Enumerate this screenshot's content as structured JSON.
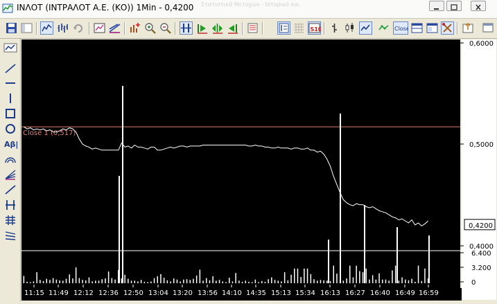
{
  "window": {
    "title": "ΙΝΛΟΤ (ΙΝΤΡΑΛΟΤ Α.Ε. (ΚΟ)) 1Min - 0,4200",
    "background_ghost_text": "Στατιστικά Μετοχών - Ιστορικό και",
    "buttons": [
      "minimize",
      "maximize",
      "close"
    ]
  },
  "toolbar": {
    "close_button_label": "Close",
    "scale_icon_label": "S\n10",
    "buttons": [
      "save-icon",
      "window-icon",
      "line-chart-icon",
      "bar-chart-icon",
      "refresh-icon",
      "chart-settings-icon",
      "indicator-icon",
      "add-indicator-icon",
      "zoom-in-icon",
      "zoom-out-icon",
      "split-panes-icon",
      "scroll-right-icon",
      "scroll-both-icon",
      "scroll-left-icon",
      "data-window-icon",
      "period-icon",
      "grid-icon",
      "scale-icon",
      "ohlc-icon",
      "candlestick-icon",
      "line-style-icon",
      "close-line-icon",
      "close-button",
      "panes-icon",
      "template-icon",
      "tools-icon",
      "export-icon",
      "new-window-icon"
    ]
  },
  "left_tools": [
    "chart-type-icon",
    "trendline-icon",
    "horizontal-line-icon",
    "vertical-line-icon",
    "rectangle-icon",
    "ellipse-icon",
    "text-tool-icon",
    "arc-icon",
    "fan-icon",
    "ray-icon",
    "channel-icon",
    "fibonacci-icon",
    "pitchfork-icon"
  ],
  "text_tool_label": "Αβ|",
  "colors": {
    "plot_bg": "#000000",
    "price_line": "#ffffff",
    "volume_bars": "#ffffff",
    "reference_line": "#e08070",
    "reference_label": "#e08070",
    "axis_panel": "#ffffff",
    "divider": "#ffffff"
  },
  "chart_data": [
    {
      "type": "line",
      "series": [
        {
          "values": [
            0.517,
            0.515,
            0.516,
            0.514,
            0.515,
            0.514,
            0.515,
            0.513,
            0.514,
            0.512,
            0.512,
            0.513,
            0.515,
            0.514,
            0.516,
            0.515,
            0.512,
            0.505,
            0.5,
            0.498,
            0.497,
            0.495,
            0.496,
            0.495,
            0.494,
            0.494,
            0.494,
            0.494,
            0.494,
            0.494,
            0.501,
            0.497,
            0.498,
            0.496,
            0.499,
            0.497,
            0.497,
            0.496,
            0.495,
            0.497,
            0.497,
            0.494,
            0.494,
            0.495,
            0.496,
            0.497,
            0.496,
            0.497,
            0.498,
            0.498,
            0.497,
            0.498,
            0.498,
            0.498,
            0.498,
            0.499,
            0.499,
            0.499,
            0.499,
            0.499,
            0.499,
            0.499,
            0.499,
            0.499,
            0.499,
            0.499,
            0.499,
            0.499,
            0.499,
            0.498,
            0.498,
            0.499,
            0.498,
            0.498,
            0.497,
            0.497,
            0.496,
            0.496,
            0.497,
            0.496,
            0.496,
            0.496,
            0.495,
            0.496,
            0.496,
            0.495,
            0.495,
            0.496,
            0.494,
            0.494,
            0.492,
            0.493,
            0.49,
            0.485,
            0.478,
            0.468,
            0.46,
            0.452,
            0.445,
            0.442,
            0.44,
            0.439,
            0.441,
            0.44,
            0.44,
            0.438,
            0.437,
            0.438,
            0.436,
            0.434,
            0.433,
            0.432,
            0.43,
            0.428,
            0.427,
            0.425,
            0.426,
            0.424,
            0.422,
            0.425,
            0.42,
            0.422,
            0.419,
            0.421,
            0.424
          ]
        }
      ],
      "x_tick_labels": [
        "11:15",
        "11:49",
        "12:12",
        "12:36",
        "12:50",
        "13:04",
        "13:20",
        "13:56",
        "14:10",
        "14:35",
        "15:13",
        "15:34",
        "16:13",
        "16:27",
        "16:40",
        "16:49",
        "16:59"
      ],
      "y_tick_labels": [
        "0,6000",
        "0,5000",
        "0,4000"
      ],
      "ylim": [
        0.4,
        0.6
      ],
      "current_value_label": "0,4200",
      "current_value": 0.42,
      "reference_line": {
        "label": "Close 1 (0,517)",
        "value": 0.517
      },
      "grid": false
    },
    {
      "type": "bar",
      "y_tick_labels": [
        "6.400",
        "3.200",
        "0"
      ],
      "ylim": [
        0,
        8500
      ],
      "values": [
        2000,
        400,
        300,
        500,
        3000,
        900,
        600,
        1200,
        900,
        1400,
        1000,
        800,
        700,
        1200,
        2400,
        1300,
        4300,
        1400,
        900,
        800,
        1600,
        500,
        700,
        700,
        1100,
        1300,
        3200,
        1400,
        1000,
        3600,
        1300,
        2300,
        1200,
        700,
        700,
        500,
        900,
        400,
        300,
        500,
        1400,
        1900,
        2500,
        1500,
        800,
        500,
        1300,
        1000,
        500,
        1000,
        1100,
        900,
        1200,
        2100,
        3700,
        700,
        1400,
        800,
        1900,
        700,
        900,
        500,
        300,
        1500,
        500,
        2800,
        700,
        400,
        700,
        400,
        300,
        1000,
        300,
        600,
        400,
        1100,
        1600,
        900,
        700,
        500,
        3000,
        800,
        2300,
        4000,
        4000,
        1700,
        4000,
        4000,
        2500,
        1100,
        700,
        900,
        800,
        700,
        600,
        4800,
        2600,
        800,
        700,
        1300,
        4800,
        1600,
        4800,
        3300,
        3000,
        4000,
        1000,
        2200,
        1000,
        2700,
        1000,
        1000,
        700,
        3500,
        4800,
        700,
        1600,
        1000,
        800,
        1200,
        400,
        4800,
        600,
        4000,
        1300
      ]
    }
  ]
}
